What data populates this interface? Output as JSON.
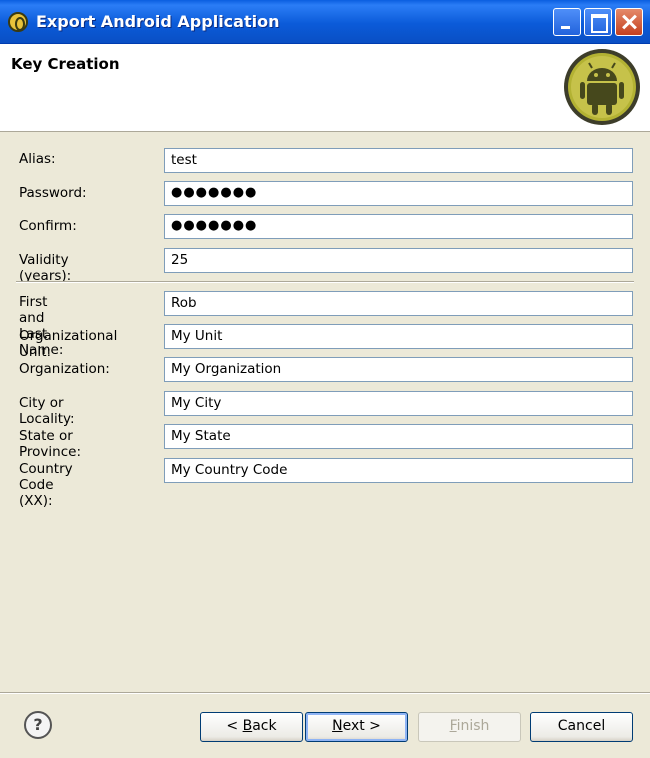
{
  "window": {
    "title": "Export Android Application"
  },
  "banner": {
    "title": "Key Creation"
  },
  "fields_group1": [
    {
      "label": "Alias:",
      "value": "test"
    },
    {
      "label": "Password:",
      "value": "●●●●●●●"
    },
    {
      "label": "Confirm:",
      "value": "●●●●●●●"
    },
    {
      "label": "Validity (years):",
      "value": "25"
    }
  ],
  "fields_group2": [
    {
      "label": "First and Last Name:",
      "value": "Rob"
    },
    {
      "label": "Organizational Unit:",
      "value": "My Unit"
    },
    {
      "label": "Organization:",
      "value": "My Organization"
    },
    {
      "label": "City or Locality:",
      "value": "My City"
    },
    {
      "label": "State or Province:",
      "value": "My State"
    },
    {
      "label": "Country Code (XX):",
      "value": "My Country Code"
    }
  ],
  "buttons": {
    "back_prefix": "< ",
    "back_mnemonic": "B",
    "back_rest": "ack",
    "next_mnemonic": "N",
    "next_rest": "ext >",
    "finish_mnemonic": "F",
    "finish_rest": "inish",
    "cancel": "Cancel",
    "help": "?"
  },
  "icons": {
    "app": "eclipse-icon",
    "logo": "android-logo-icon",
    "help": "help-icon"
  }
}
